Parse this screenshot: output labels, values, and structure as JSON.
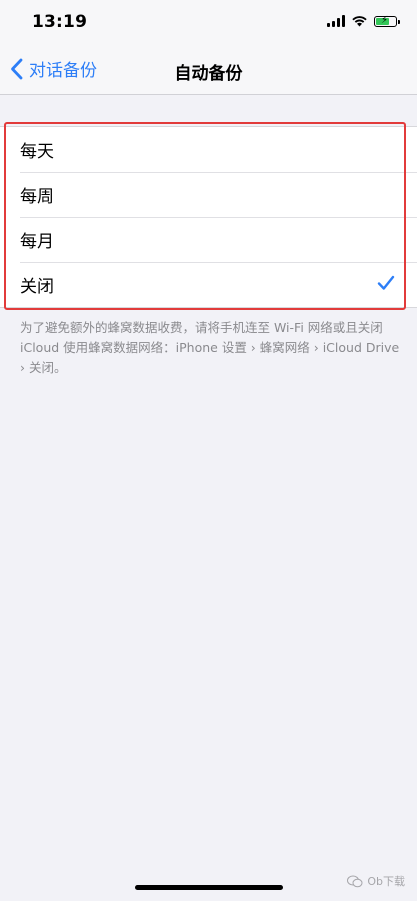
{
  "status_bar": {
    "time": "13:19"
  },
  "nav": {
    "back_label": "对话备份",
    "title": "自动备份"
  },
  "options": [
    {
      "label": "每天",
      "selected": false
    },
    {
      "label": "每周",
      "selected": false
    },
    {
      "label": "每月",
      "selected": false
    },
    {
      "label": "关闭",
      "selected": true
    }
  ],
  "footer_note": "为了避免额外的蜂窝数据收费，请将手机连至 Wi-Fi 网络或且关闭 iCloud 使用蜂窝数据网络：iPhone 设置 › 蜂窝网络 › iCloud Drive › 关闭。",
  "watermark": "Ob下载",
  "colors": {
    "accent": "#2d7ef7",
    "highlight": "#e23b3b"
  }
}
